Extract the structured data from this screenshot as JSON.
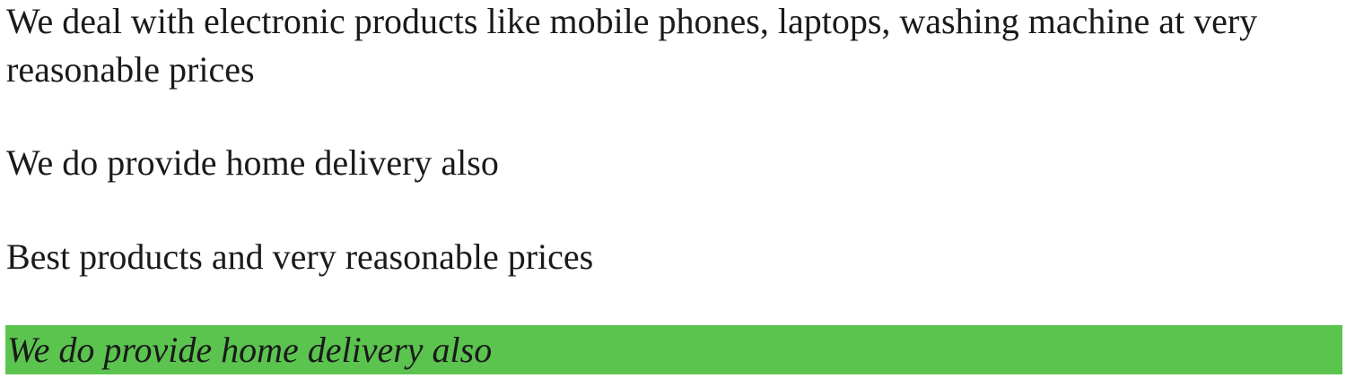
{
  "paragraphs": [
    "We deal with electronic products like mobile phones, laptops, washing machine at very reasonable prices",
    "We do provide home delivery also",
    "Best products and very reasonable prices",
    "We do provide home delivery also"
  ],
  "colors": {
    "highlight": "#5bc44f",
    "text": "#1a1a1a"
  }
}
